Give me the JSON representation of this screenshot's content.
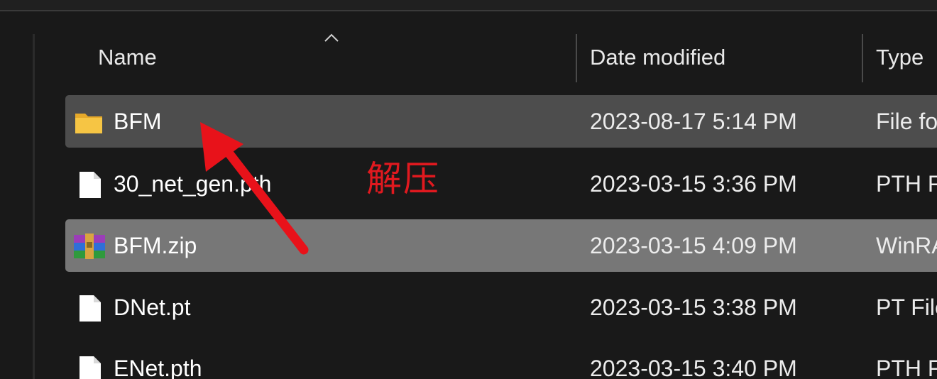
{
  "columns": {
    "name": "Name",
    "date_modified": "Date modified",
    "type": "Type"
  },
  "files": [
    {
      "name": "BFM",
      "date": "2023-08-17 5:14 PM",
      "type": "File fo",
      "icon": "folder-icon",
      "state": "selected"
    },
    {
      "name": "30_net_gen.pth",
      "date": "2023-03-15 3:36 PM",
      "type": "PTH F",
      "icon": "document-icon",
      "state": "normal"
    },
    {
      "name": "BFM.zip",
      "date": "2023-03-15 4:09 PM",
      "type": "WinRA",
      "icon": "winrar-archive-icon",
      "state": "hover"
    },
    {
      "name": "DNet.pt",
      "date": "2023-03-15 3:38 PM",
      "type": "PT File",
      "icon": "document-icon",
      "state": "normal"
    },
    {
      "name": "ENet.pth",
      "date": "2023-03-15 3:40 PM",
      "type": "PTH F",
      "icon": "document-icon",
      "state": "normal"
    }
  ],
  "annotation": {
    "text": "解压",
    "color": "#e1191f"
  },
  "colors": {
    "background": "#191919",
    "selected_row": "#4d4d4d",
    "hover_row": "#777777",
    "folder": "#f6c544"
  }
}
